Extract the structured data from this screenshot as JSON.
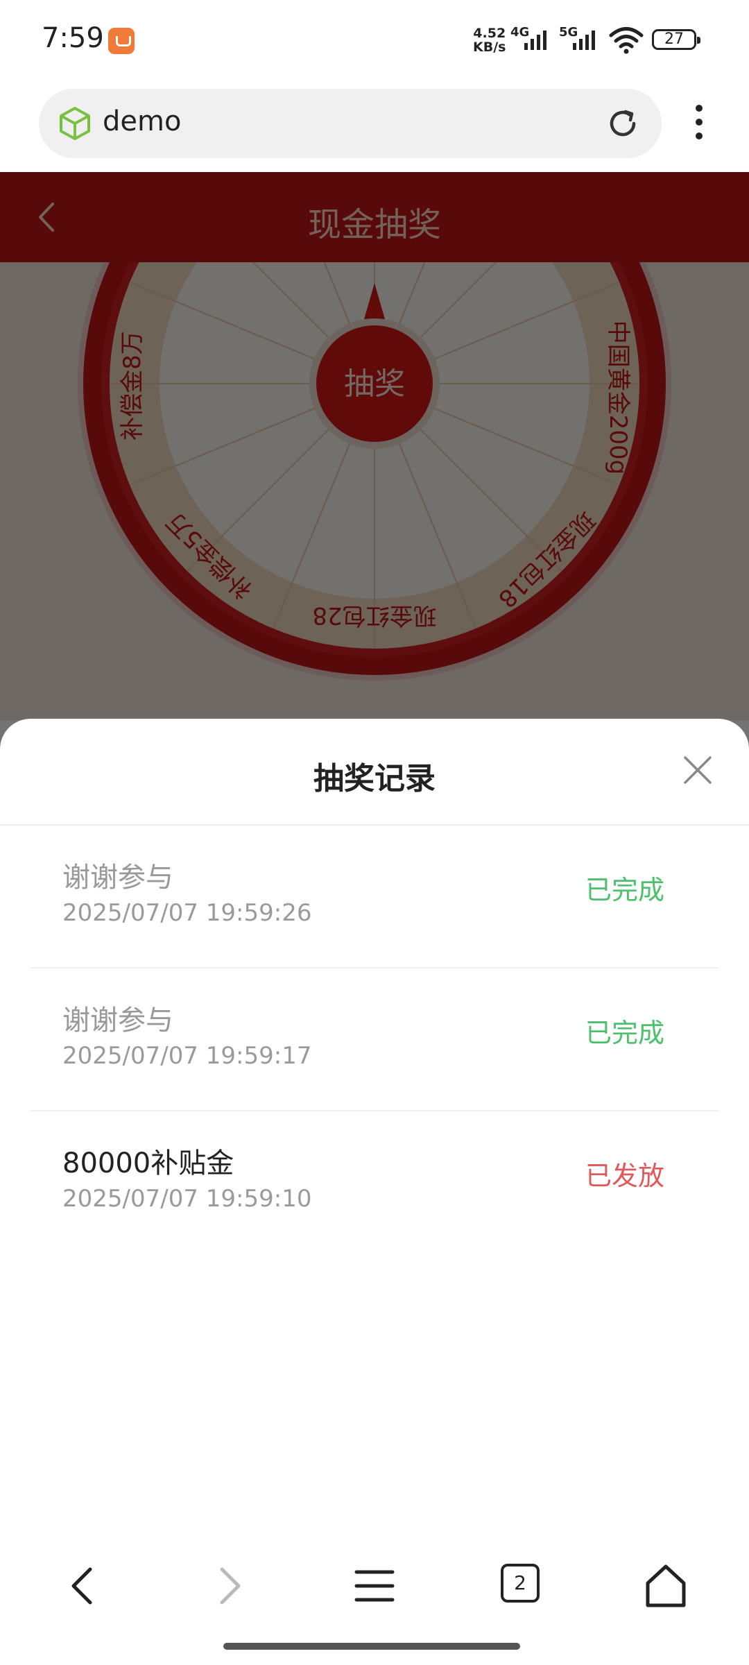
{
  "status_bar": {
    "time": "7:59",
    "net_speed_value": "4.52",
    "net_speed_unit": "KB/s",
    "signal_1": "4G",
    "signal_2": "5G",
    "battery": "27",
    "icons": [
      "app-notification-icon",
      "signal-4g-icon",
      "signal-5g-icon",
      "wifi-icon",
      "battery-icon"
    ]
  },
  "browser": {
    "address": "demo",
    "icons": [
      "site-cube-icon",
      "reload-icon",
      "more-vert-icon"
    ]
  },
  "header": {
    "title": "现金抽奖"
  },
  "wheel": {
    "button_label": "抽奖",
    "prizes": [
      "中国黄金200g",
      "现金红包18",
      "现金红包28",
      "补偿金5万",
      "补偿金8万"
    ],
    "colors": {
      "outer_ring": "#c41414",
      "inner_ring": "#f3dcc0",
      "pointer": "#c41414"
    }
  },
  "sheet": {
    "title": "抽奖记录",
    "records": [
      {
        "name": "谢谢参与",
        "time": "2025/07/07 19:59:26",
        "status": "已完成",
        "name_color": "#999999",
        "status_color": "#4cc16b"
      },
      {
        "name": "谢谢参与",
        "time": "2025/07/07 19:59:17",
        "status": "已完成",
        "name_color": "#999999",
        "status_color": "#4cc16b"
      },
      {
        "name": "80000补贴金",
        "time": "2025/07/07 19:59:10",
        "status": "已发放",
        "name_color": "#222222",
        "status_color": "#e0585a"
      }
    ]
  },
  "bottom_nav": {
    "tab_count": "2",
    "icons": [
      "back-icon",
      "forward-icon",
      "menu-lines-icon",
      "tabs-icon",
      "home-icon"
    ]
  }
}
